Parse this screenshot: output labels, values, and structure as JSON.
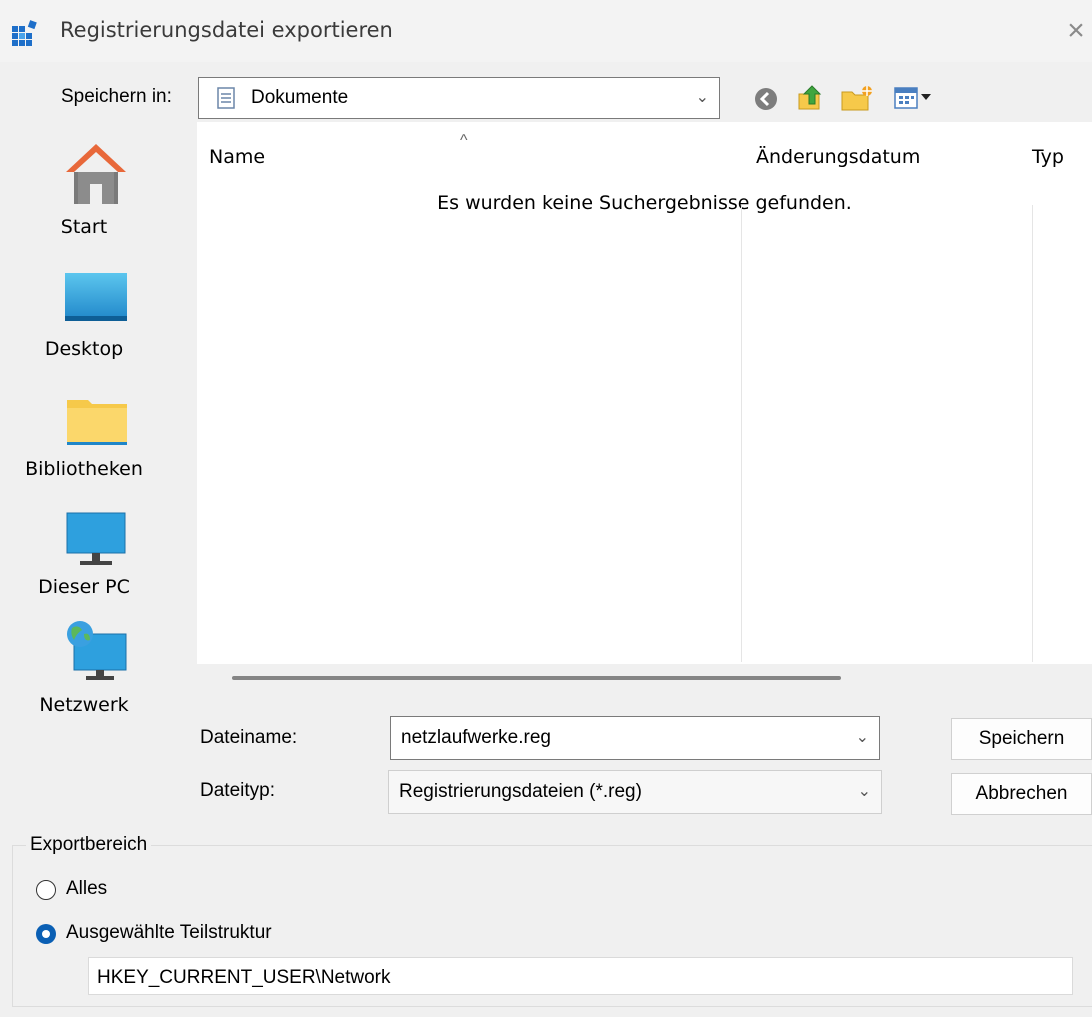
{
  "window": {
    "title": "Registrierungsdatei exportieren",
    "close_glyph": "×"
  },
  "toolbar": {
    "save_in_label": "Speichern in:",
    "location": "Dokumente",
    "icons": [
      "back-icon",
      "up-folder-icon",
      "new-folder-icon",
      "view-menu-icon"
    ]
  },
  "places": [
    {
      "label": "Start",
      "icon": "home-icon"
    },
    {
      "label": "Desktop",
      "icon": "desktop-icon"
    },
    {
      "label": "Bibliotheken",
      "icon": "libraries-icon"
    },
    {
      "label": "Dieser PC",
      "icon": "this-pc-icon"
    },
    {
      "label": "Netzwerk",
      "icon": "network-icon"
    }
  ],
  "file_list": {
    "columns": [
      "Name",
      "Änderungsdatum",
      "Typ"
    ],
    "empty_message": "Es wurden keine Suchergebnisse gefunden.",
    "sort_indicator": "^"
  },
  "form": {
    "filename_label": "Dateiname:",
    "filename_value": "netzlaufwerke.reg",
    "filetype_label": "Dateityp:",
    "filetype_value": "Registrierungsdateien (*.reg)",
    "save_button": "Speichern",
    "cancel_button": "Abbrechen"
  },
  "export_range": {
    "legend": "Exportbereich",
    "option_all": "Alles",
    "option_branch": "Ausgewählte Teilstruktur",
    "selected": "branch",
    "branch_value": "HKEY_CURRENT_USER\\Network"
  },
  "colors": {
    "accent": "#0a5fb4",
    "folder": "#f6c94a",
    "home_roof": "#e8683a"
  }
}
